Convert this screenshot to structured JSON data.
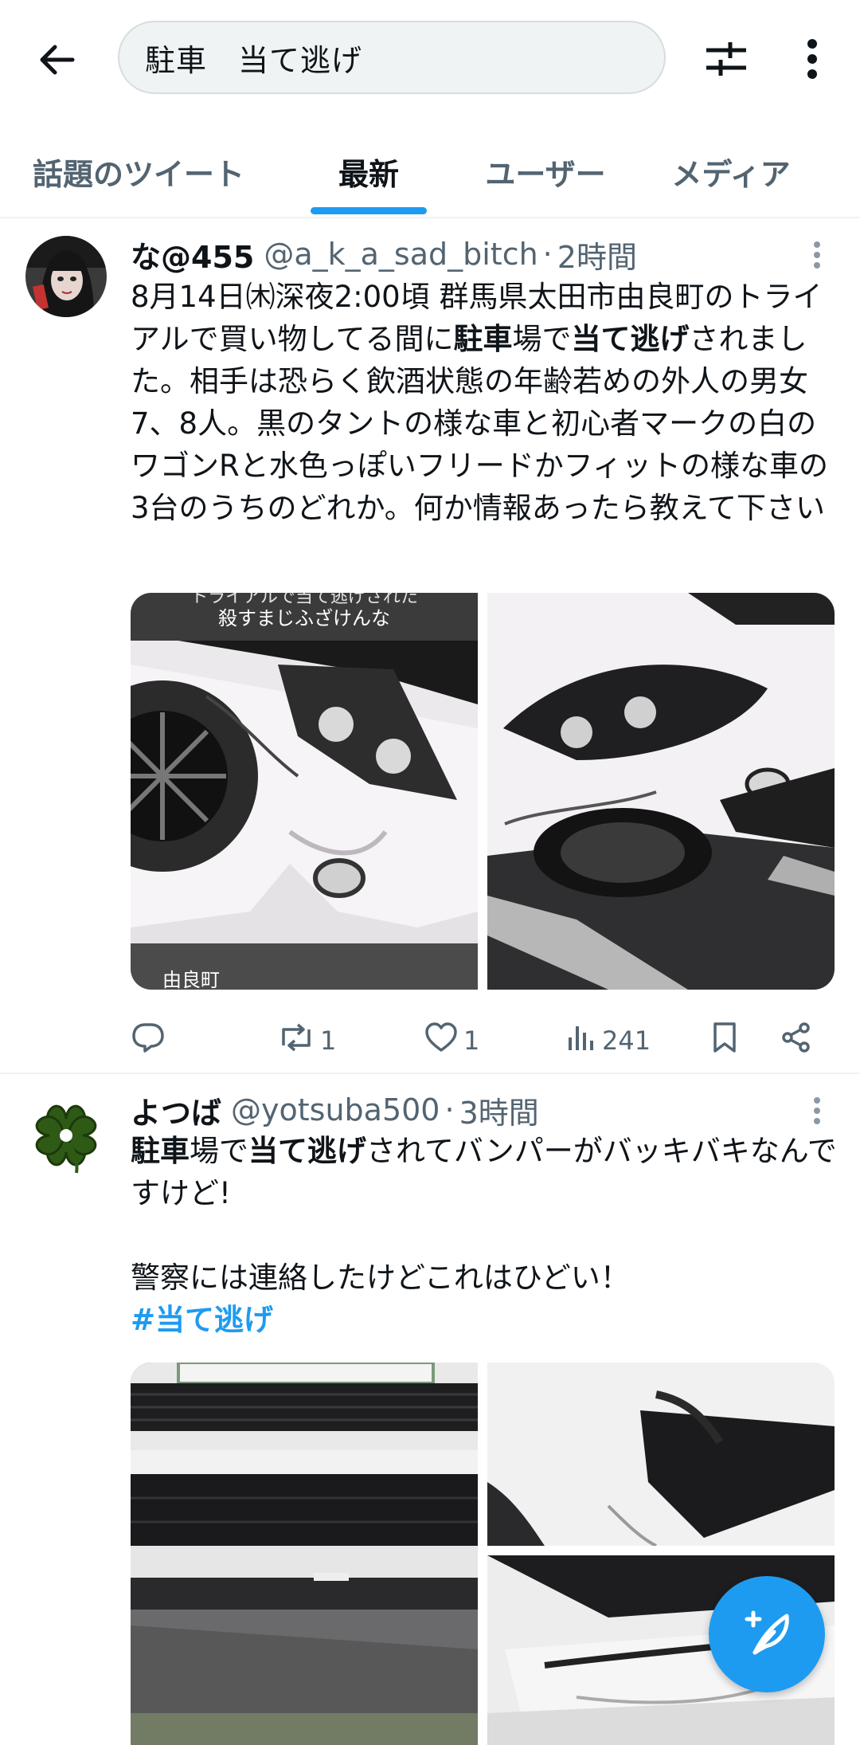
{
  "search": {
    "query": "駐車　当て逃げ"
  },
  "tabs": [
    {
      "label": "話題のツイート"
    },
    {
      "label": "最新"
    },
    {
      "label": "ユーザー"
    },
    {
      "label": "メディア"
    }
  ],
  "active_tab": "最新",
  "colors": {
    "accent": "#1d9bf0",
    "text": "#0f1419",
    "secondary": "#536471",
    "divider": "#eff3f4"
  },
  "tweets": [
    {
      "name": "な@455",
      "handle": "@a_k_a_sad_bitch",
      "time": "2時間",
      "text": {
        "p1": "8月14日㈭深夜2:00頃 群馬県太田市由良町のトライアルで買い物してる間に",
        "b1": "駐車",
        "p2": "場で",
        "b2": "当て逃げ",
        "p3": "されました。相手は恐らく飲酒状態の年齢若めの外人の男女7、8人。黒のタントの様な車と初心者マークの白のワゴンRと水色っぽいフリードかフィットの様な車の3台のうちのどれか。何か情報あったら教えて下さい"
      },
      "image_caption_top": "殺すまじふざけんな",
      "image_caption_top_partial": "トライアルで当て逃げされた",
      "image_caption_bottom": "由良町",
      "stats": {
        "replies": "",
        "retweets": "1",
        "likes": "1",
        "views": "241"
      }
    },
    {
      "name": "よつば",
      "handle": "@yotsuba500",
      "time": "3時間",
      "text": {
        "b1": "駐車",
        "p1": "場で",
        "b2": "当て逃げ",
        "p2": "されてバンパーがバッキバキなんですけど!",
        "p3": "警察には連絡したけどこれはひどい！",
        "hashtag": "#当て逃げ"
      }
    }
  ]
}
